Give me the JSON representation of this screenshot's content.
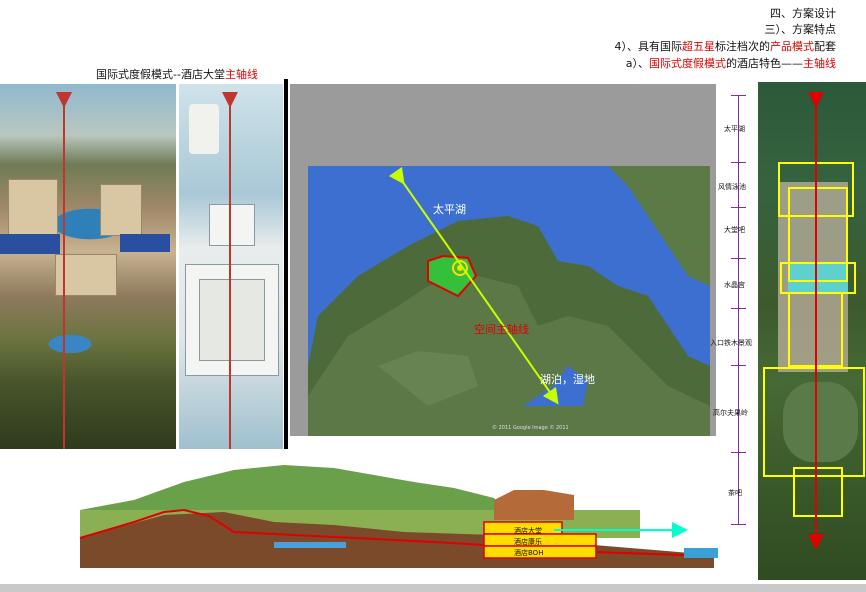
{
  "header": {
    "line1": "四、方案设计",
    "line2": "三）、方案特点",
    "line3_pre": "4）、具有国际",
    "line3_red1": "超五星",
    "line3_mid": "标注档次的",
    "line3_red2": "产品模式",
    "line3_post": "配套",
    "line4_pre": "a）、",
    "line4_red1": "国际式度假模式",
    "line4_mid": "的酒店特色——",
    "line4_red2": "主轴线"
  },
  "caption": {
    "text": "国际式度假模式--酒店大堂",
    "red": "主轴线"
  },
  "satellite": {
    "lake_label": "太平湖",
    "axis_label": "空间主轴线",
    "wetland_label": "湖泊，湿地",
    "credit": "© 2011 Google  Image © 2011"
  },
  "section_labels": [
    "酒店大堂",
    "酒店康乐",
    "酒店BOH"
  ],
  "ruler_labels": [
    "太平湖",
    "风情泳池",
    "大堂吧",
    "水晶宫",
    "入口铁木景观",
    "高尔夫果岭",
    "茶吧"
  ],
  "colors": {
    "accent_red": "#e00000",
    "axis_green": "#c8ff00",
    "section_arrow": "#00ffcc",
    "highlight_yellow": "#ffff00",
    "ruler_purple": "#8b2aa8"
  }
}
